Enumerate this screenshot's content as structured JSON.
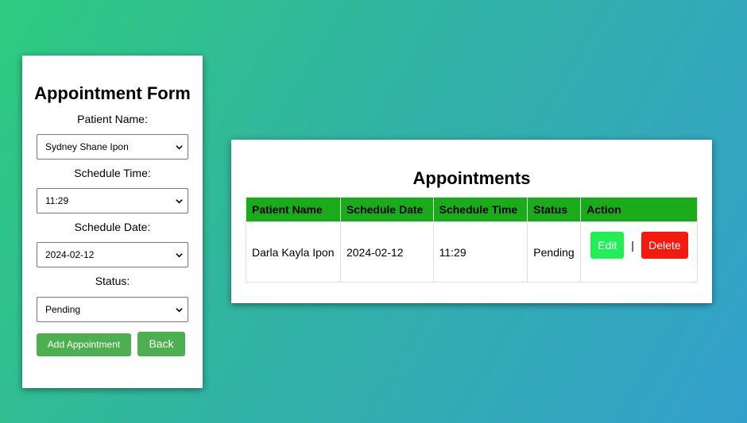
{
  "form": {
    "title": "Appointment Form",
    "patient_label": "Patient Name:",
    "patient_value": "Sydney Shane Ipon",
    "time_label": "Schedule Time:",
    "time_value": "11:29",
    "date_label": "Schedule Date:",
    "date_value": "2024-02-12",
    "status_label": "Status:",
    "status_value": "Pending",
    "add_button": "Add Appointment",
    "back_button": "Back"
  },
  "appointments": {
    "title": "Appointments",
    "columns": [
      "Patient Name",
      "Schedule Date",
      "Schedule Time",
      "Status",
      "Action"
    ],
    "rows": [
      {
        "patient": "Darla Kayla Ipon",
        "date": "2024-02-12",
        "time": "11:29",
        "status": "Pending",
        "edit_label": "Edit",
        "separator": "|",
        "delete_label": "Delete"
      }
    ]
  },
  "colors": {
    "header_green": "#1aab1a",
    "button_green": "#4caf50",
    "edit_green": "#22ee55",
    "delete_red": "#f51a0e"
  }
}
